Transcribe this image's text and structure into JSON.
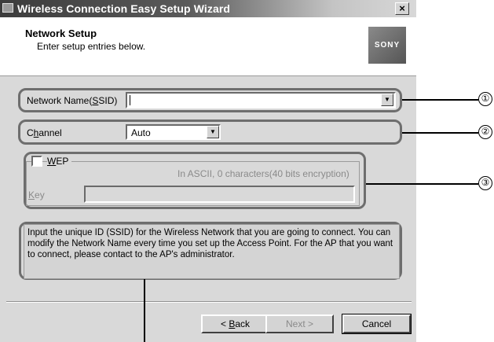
{
  "window": {
    "title": "Wireless Connection Easy Setup Wizard",
    "close_label": "×"
  },
  "header": {
    "title": "Network Setup",
    "subtitle": "Enter setup entries below.",
    "logo_text": "SONY"
  },
  "ssid": {
    "label_pre": "Network Name(",
    "label_accel": "S",
    "label_post": "SID)",
    "value": ""
  },
  "channel": {
    "label_pre": "C",
    "label_accel": "h",
    "label_post": "annel",
    "value": "Auto"
  },
  "wep": {
    "label_accel": "W",
    "label_post": "EP",
    "checked": false,
    "encryption_note": "In ASCII, 0 characters(40 bits encryption)",
    "key_label_accel": "K",
    "key_label_post": "ey",
    "key_value": ""
  },
  "info_text": "Input the unique ID (SSID) for the Wireless Network that you are going to connect. You can modify the Network Name every time you set up the Access Point. For the AP that you want to connect, please contact to the AP's administrator.",
  "buttons": {
    "back_pre": "< ",
    "back_accel": "B",
    "back_post": "ack",
    "next": "Next >",
    "cancel": "Cancel"
  },
  "callouts": [
    "①",
    "②",
    "③"
  ],
  "icons": {
    "dropdown": "▼"
  }
}
